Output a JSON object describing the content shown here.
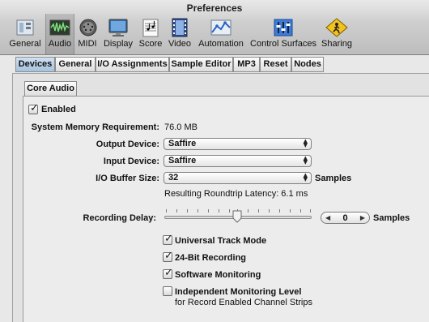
{
  "window": {
    "title": "Preferences"
  },
  "toolbar": {
    "items": [
      {
        "label": "General",
        "icon": "general-icon"
      },
      {
        "label": "Audio",
        "icon": "audio-icon",
        "selected": true
      },
      {
        "label": "MIDI",
        "icon": "midi-icon"
      },
      {
        "label": "Display",
        "icon": "display-icon"
      },
      {
        "label": "Score",
        "icon": "score-icon"
      },
      {
        "label": "Video",
        "icon": "video-icon"
      },
      {
        "label": "Automation",
        "icon": "automation-icon"
      },
      {
        "label": "Control Surfaces",
        "icon": "control-surfaces-icon"
      },
      {
        "label": "Sharing",
        "icon": "sharing-icon"
      }
    ]
  },
  "tabs": {
    "items": [
      {
        "label": "Devices",
        "active": true
      },
      {
        "label": "General"
      },
      {
        "label": "I/O Assignments"
      },
      {
        "label": "Sample Editor"
      },
      {
        "label": "MP3"
      },
      {
        "label": "Reset"
      },
      {
        "label": "Nodes"
      }
    ]
  },
  "core_audio": {
    "tab_label": "Core Audio",
    "enabled": {
      "label": "Enabled",
      "checked": true
    },
    "memory": {
      "label": "System Memory Requirement:",
      "value": "76.0 MB"
    },
    "output_device": {
      "label": "Output Device:",
      "value": "Saffire"
    },
    "input_device": {
      "label": "Input Device:",
      "value": "Saffire"
    },
    "buffer_size": {
      "label": "I/O Buffer Size:",
      "value": "32",
      "unit": "Samples"
    },
    "latency": "Resulting Roundtrip Latency: 6.1 ms",
    "recording_delay": {
      "label": "Recording Delay:",
      "value": "0",
      "unit": "Samples"
    },
    "options": [
      {
        "label": "Universal Track Mode",
        "checked": true
      },
      {
        "label": "24-Bit Recording",
        "checked": true
      },
      {
        "label": "Software Monitoring",
        "checked": true
      },
      {
        "label": "Independent Monitoring Level",
        "checked": false,
        "sublabel": "for Record Enabled Channel Strips"
      }
    ]
  },
  "colors": {
    "selected_tab": "#b8cce4",
    "window_bg": "#e8e8e8"
  }
}
